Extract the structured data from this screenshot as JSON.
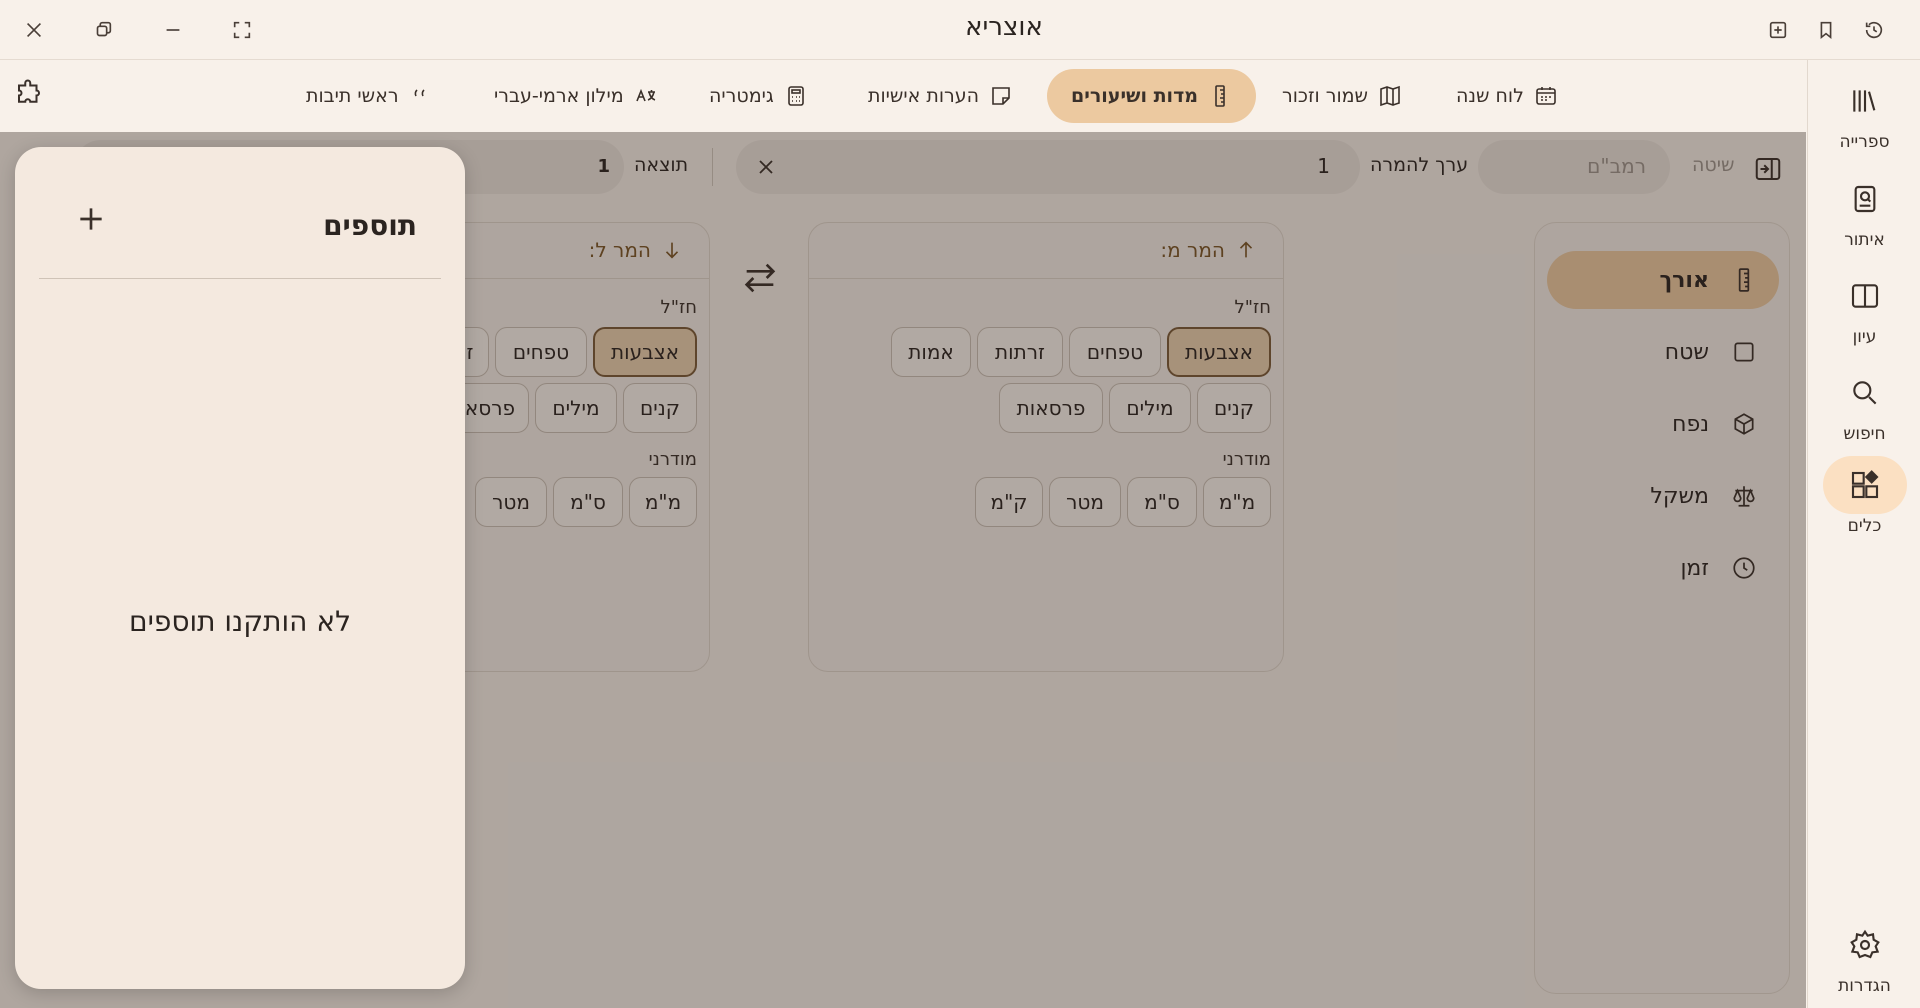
{
  "app": {
    "title": "אוצריא"
  },
  "tabs": [
    {
      "label": "לוח שנה",
      "icon": "calendar-grid-icon"
    },
    {
      "label": "שמור וזכור",
      "icon": "book-map-icon"
    },
    {
      "label": "מדות ושיעורים",
      "icon": "ruler-icon",
      "active": true
    },
    {
      "label": "הערות אישיות",
      "icon": "note-icon"
    },
    {
      "label": "גימטריה",
      "icon": "calculator-icon"
    },
    {
      "label": "מילון ארמי-עברי",
      "icon": "translate-icon"
    },
    {
      "label": "ראשי תיבות",
      "icon": "quote-icon"
    }
  ],
  "rail": [
    {
      "label": "ספרייה",
      "icon": "library-icon"
    },
    {
      "label": "איתור",
      "icon": "find-book-icon"
    },
    {
      "label": "עיון",
      "icon": "open-book-icon"
    },
    {
      "label": "חיפוש",
      "icon": "search-icon"
    },
    {
      "label": "כלים",
      "icon": "tools-icon",
      "active": true
    },
    {
      "label": "הגדרות",
      "icon": "settings-icon"
    }
  ],
  "toolbar": {
    "method_label": "שיטה",
    "method_placeholder": "רמב\"ם",
    "convert_value_label": "ערך להמרה",
    "convert_value": "1",
    "result_label": "תוצאה",
    "result_value": "1"
  },
  "units": [
    {
      "label": "אורך",
      "icon": "ruler-icon",
      "active": true
    },
    {
      "label": "שטח",
      "icon": "square-icon"
    },
    {
      "label": "נפח",
      "icon": "cube-icon"
    },
    {
      "label": "משקל",
      "icon": "scale-icon"
    },
    {
      "label": "זמן",
      "icon": "clock-icon"
    }
  ],
  "from_card": {
    "title": "המר מ:",
    "section1": "חז\"ל",
    "row1": [
      "אצבעות",
      "טפחים",
      "זרתות",
      "אמות"
    ],
    "row2": [
      "קנים",
      "מילים",
      "פרסאות"
    ],
    "section2": "מודרני",
    "row3": [
      "מ\"מ",
      "ס\"מ",
      "מטר",
      "ק\"מ"
    ],
    "selected": "אצבעות"
  },
  "to_card": {
    "title": "המר ל:",
    "section1": "חז\"ל",
    "row1": [
      "אצבעות",
      "טפחים",
      "ז"
    ],
    "row2": [
      "קנים",
      "מילים",
      "פרסא"
    ],
    "section2": "מודרני",
    "row3": [
      "מ\"מ",
      "ס\"מ",
      "מטר"
    ],
    "selected": "אצבעות"
  },
  "addons": {
    "title": "תוספים",
    "empty_message": "לא הותקנו תוספים"
  }
}
